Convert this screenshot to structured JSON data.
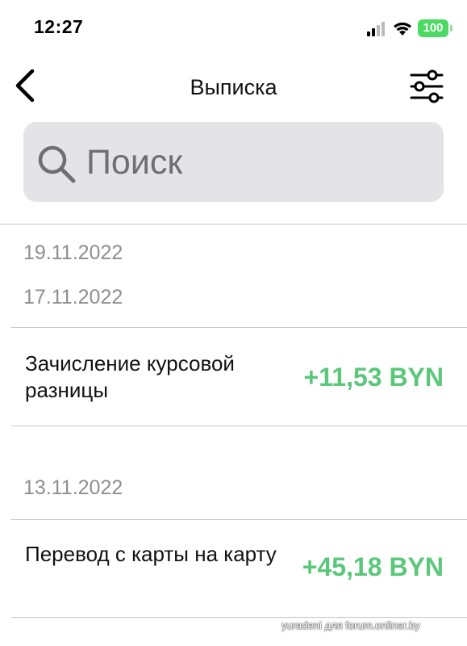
{
  "status_bar": {
    "time": "12:27",
    "battery_level": "100",
    "icons": [
      "signal-icon",
      "wifi-icon",
      "battery-icon"
    ],
    "battery_color": "#4cd964"
  },
  "nav": {
    "title": "Выписка",
    "back_icon": "chevron-left-icon",
    "filter_icon": "sliders-icon"
  },
  "search": {
    "placeholder": "Поиск",
    "icon": "search-icon"
  },
  "dates": [
    "19.11.2022",
    "17.11.2022",
    "13.11.2022"
  ],
  "transactions": [
    {
      "description": "Зачисление курсовой разницы",
      "amount": "+11,53 BYN"
    },
    {
      "description": "Перевод с карты на карту",
      "amount": "+45,18 BYN"
    }
  ],
  "colors": {
    "amount_positive": "#5ac77a",
    "date_text": "#8e8e93",
    "search_bg": "#e4e4e6"
  },
  "watermark": "yuradeni для forum.onliner.by"
}
